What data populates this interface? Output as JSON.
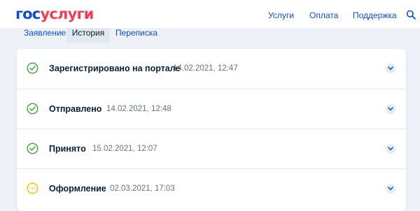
{
  "header": {
    "logo_part1": "гос",
    "logo_part2": "услуги",
    "nav": [
      "Услуги",
      "Оплата",
      "Поддержка"
    ],
    "search_icon": "search-icon"
  },
  "tabs": [
    {
      "label": "Заявление",
      "active": false
    },
    {
      "label": "История",
      "active": true
    },
    {
      "label": "Переписка",
      "active": false
    }
  ],
  "history": [
    {
      "title": "Зарегистрировано на портале",
      "date": "14.02.2021, 12:47",
      "status": "done",
      "icon": "check-circle-icon"
    },
    {
      "title": "Отправлено",
      "date": "14.02.2021, 12:48",
      "status": "done",
      "icon": "check-circle-icon"
    },
    {
      "title": "Принято",
      "date": "15.02.2021, 12:07",
      "status": "done",
      "icon": "check-circle-icon"
    },
    {
      "title": "Оформление",
      "date": "02.03.2021, 17:03",
      "status": "in-progress",
      "icon": "pending-circle-icon"
    }
  ],
  "colors": {
    "brand_blue": "#0d4cd3",
    "brand_red": "#ee3f58",
    "success": "#41a33a",
    "pending": "#f5bd00",
    "background": "#eef2f8"
  }
}
